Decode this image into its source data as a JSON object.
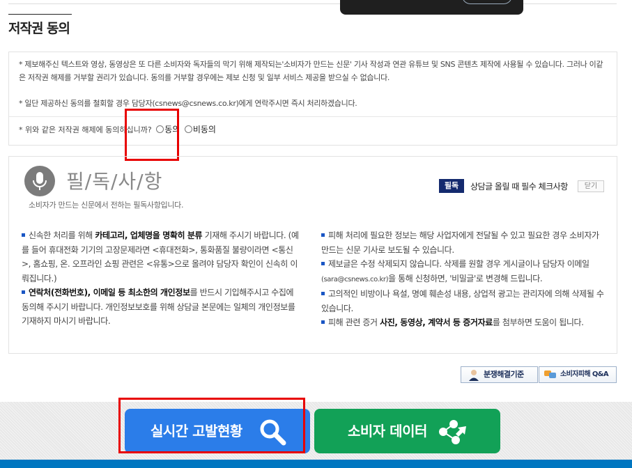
{
  "consent": {
    "title": "저작권 동의",
    "paragraph1": "* 제보해주신 텍스트와 영상, 동영상은 또 다른 소비자와 독자들의 막기 위해 제작되는'소비자가 만드는 신문' 기사 작성과 연관 유튜브 및 SNS 콘텐츠 제작에 사용될 수 있습니다. 그러나 이같은 저작권 해제를 거부할 권리가 있습니다. 동의를 거부할 경우에는 제보 신청 및 일부 서비스 제공을 받으실 수 없습니다.",
    "paragraph2": "* 일단 제공하신 동의를 철회할 경우 담당자(csnews@csnews.co.kr)에게 연락주시면 즉시 처리하겠습니다.",
    "question": "* 위와 같은 저작권 해제에 동의하십니까?",
    "agree_label": "동의",
    "disagree_label": "비동의"
  },
  "notice": {
    "title": "필/독/사/항",
    "subtitle": "소비자가 만드는 신문에서 전하는 필독사항입니다.",
    "badge": "필독",
    "badge_text": "상담글 올릴 때 필수 체크사항",
    "close_label": "닫기",
    "left": {
      "i1_pre": "신속한 처리를 위해 ",
      "i1_bold": "카테고리, 업체명을 명확히 분류",
      "i1_post": " 기재해 주시기 바랍니다. (예를 들어 휴대전화 기기의 고장문제라면 <휴대전화>, 통화품질 불량이라면 <통신>, 홈쇼핑, 온. 오프라인 쇼핑 관련은 <유통>으로 올려야 담당자 확인이 신속히 이뤄집니다.)",
      "i2_bold": "연락처(전화번호), 이메일 등 최소한의 개인정보",
      "i2_post": "를 반드시 기입해주시고 수집에 동의해 주시기 바랍니다. 개인정보보호를 위해 상담글 본문에는 일체의 개인정보를 기재하지 마시기 바랍니다."
    },
    "right": {
      "i1": "피해 처리에 필요한 정보는 해당 사업자에게 전달될 수 있고 필요한 경우 소비자가 만드는 신문 기사로 보도될 수 있습니다.",
      "i2_pre": "제보글은 수정 삭제되지 않습니다. 삭제를 원할 경우 게시글이나 담당자 이메일 ",
      "i2_email": "(sara@csnews.co.kr)",
      "i2_post": "을 통해 신청하면, '비밀글'로 변경해 드립니다.",
      "i3": "고의적인 비방이나 욕설, 명예 훼손성 내용, 상업적 광고는 관리자에 의해 삭제될 수 있습니다.",
      "i4_pre": "피해 관련 증거 ",
      "i4_bold": "사진, 동영상, 계약서 등 증거자료",
      "i4_post": "를 첨부하면 도움이 됩니다."
    }
  },
  "links": {
    "dispute": "분쟁해결기준",
    "qa": "소비자피해 Q&A"
  },
  "actions": {
    "realtime": "실시간 고발현황",
    "consumer_data": "소비자 데이터"
  },
  "colors": {
    "realtime_button": "#2b7de9",
    "consumer_button": "#12a157",
    "badge": "#142a6e",
    "highlight": "#e80000"
  }
}
